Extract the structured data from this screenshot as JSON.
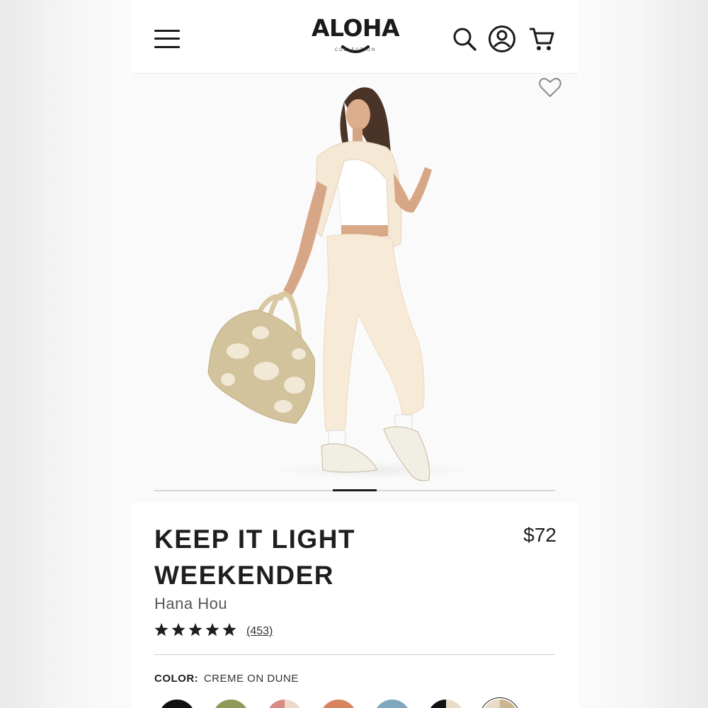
{
  "header": {
    "logo_text": "ALOHA",
    "logo_subtext": "COLLECTION",
    "icons": [
      "hamburger-menu-icon",
      "search-icon",
      "account-icon",
      "cart-icon"
    ]
  },
  "gallery": {
    "slide_count_indicator": "1",
    "wishlist_icon": "heart-icon"
  },
  "product": {
    "title_line1": "KEEP IT LIGHT",
    "title_line2": "WEEKENDER",
    "price": "$72",
    "brand": "Hana Hou",
    "rating": 5,
    "review_count": "(453)",
    "color_label": "COLOR:",
    "color_value": "CREME ON DUNE"
  },
  "swatches": [
    {
      "name": "black",
      "colors": [
        "#111111",
        "#111111"
      ]
    },
    {
      "name": "olive",
      "colors": [
        "#8e9a57",
        "#8e9a57"
      ]
    },
    {
      "name": "pink-cream",
      "colors": [
        "#d88b84",
        "#ecd9c9"
      ]
    },
    {
      "name": "terracotta",
      "colors": [
        "#d8855f",
        "#d8855f"
      ]
    },
    {
      "name": "blue",
      "colors": [
        "#7fa7bd",
        "#7fa7bd"
      ]
    },
    {
      "name": "black-cream",
      "colors": [
        "#111111",
        "#e9dcc6"
      ]
    },
    {
      "name": "creme-on-dune",
      "colors": [
        "#e9dcc6",
        "#cbb68f"
      ]
    }
  ],
  "colors": {
    "text": "#1e1e1e",
    "muted": "#555555",
    "divider": "#cfcfcf"
  }
}
